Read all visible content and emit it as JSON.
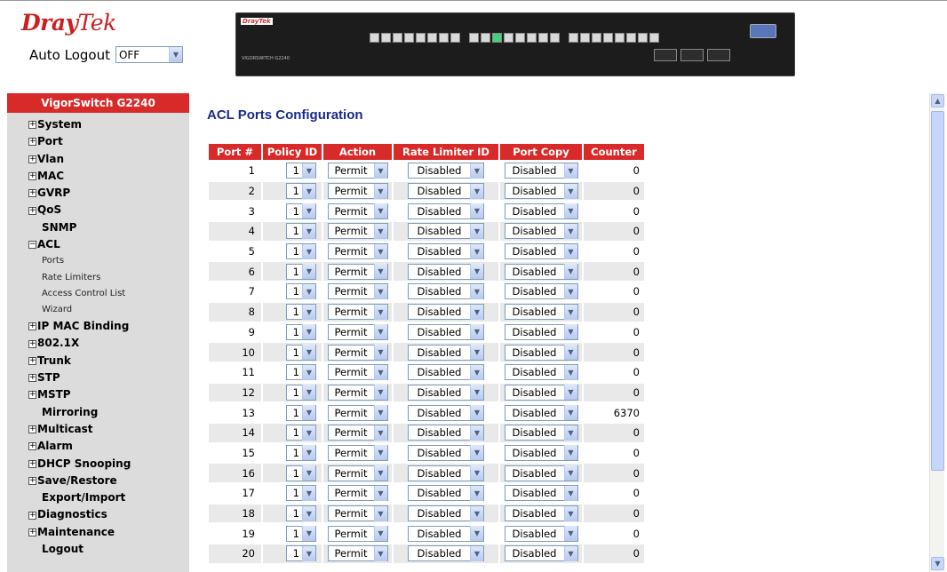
{
  "header": {
    "brand_bold": "Dray",
    "brand_light": "Tek",
    "auto_logout_label": "Auto Logout",
    "auto_logout_value": "OFF",
    "device_brand": "DrayTek",
    "device_model": "VIGORSWITCH G2240"
  },
  "sidebar": {
    "title": "VigorSwitch G2240",
    "items": [
      {
        "label": "System",
        "type": "collapsed"
      },
      {
        "label": "Port",
        "type": "collapsed"
      },
      {
        "label": "Vlan",
        "type": "collapsed"
      },
      {
        "label": "MAC",
        "type": "collapsed"
      },
      {
        "label": "GVRP",
        "type": "collapsed"
      },
      {
        "label": "QoS",
        "type": "collapsed"
      },
      {
        "label": "SNMP",
        "type": "leaf"
      },
      {
        "label": "ACL",
        "type": "expanded"
      },
      {
        "label": "Ports",
        "type": "sub"
      },
      {
        "label": "Rate Limiters",
        "type": "sub"
      },
      {
        "label": "Access Control List",
        "type": "sub"
      },
      {
        "label": "Wizard",
        "type": "sub"
      },
      {
        "label": "IP MAC Binding",
        "type": "collapsed"
      },
      {
        "label": "802.1X",
        "type": "collapsed"
      },
      {
        "label": "Trunk",
        "type": "collapsed"
      },
      {
        "label": "STP",
        "type": "collapsed"
      },
      {
        "label": "MSTP",
        "type": "collapsed"
      },
      {
        "label": "Mirroring",
        "type": "leaf"
      },
      {
        "label": "Multicast",
        "type": "collapsed"
      },
      {
        "label": "Alarm",
        "type": "collapsed"
      },
      {
        "label": "DHCP Snooping",
        "type": "collapsed"
      },
      {
        "label": "Save/Restore",
        "type": "collapsed"
      },
      {
        "label": "Export/Import",
        "type": "leaf"
      },
      {
        "label": "Diagnostics",
        "type": "collapsed"
      },
      {
        "label": "Maintenance",
        "type": "collapsed"
      },
      {
        "label": "Logout",
        "type": "leaf"
      }
    ]
  },
  "main": {
    "title": "ACL Ports Configuration",
    "columns": [
      "Port #",
      "Policy ID",
      "Action",
      "Rate Limiter ID",
      "Port Copy",
      "Counter"
    ],
    "rows": [
      {
        "port": "1",
        "policy": "1",
        "action": "Permit",
        "rate": "Disabled",
        "copy": "Disabled",
        "counter": "0"
      },
      {
        "port": "2",
        "policy": "1",
        "action": "Permit",
        "rate": "Disabled",
        "copy": "Disabled",
        "counter": "0"
      },
      {
        "port": "3",
        "policy": "1",
        "action": "Permit",
        "rate": "Disabled",
        "copy": "Disabled",
        "counter": "0"
      },
      {
        "port": "4",
        "policy": "1",
        "action": "Permit",
        "rate": "Disabled",
        "copy": "Disabled",
        "counter": "0"
      },
      {
        "port": "5",
        "policy": "1",
        "action": "Permit",
        "rate": "Disabled",
        "copy": "Disabled",
        "counter": "0"
      },
      {
        "port": "6",
        "policy": "1",
        "action": "Permit",
        "rate": "Disabled",
        "copy": "Disabled",
        "counter": "0"
      },
      {
        "port": "7",
        "policy": "1",
        "action": "Permit",
        "rate": "Disabled",
        "copy": "Disabled",
        "counter": "0"
      },
      {
        "port": "8",
        "policy": "1",
        "action": "Permit",
        "rate": "Disabled",
        "copy": "Disabled",
        "counter": "0"
      },
      {
        "port": "9",
        "policy": "1",
        "action": "Permit",
        "rate": "Disabled",
        "copy": "Disabled",
        "counter": "0"
      },
      {
        "port": "10",
        "policy": "1",
        "action": "Permit",
        "rate": "Disabled",
        "copy": "Disabled",
        "counter": "0"
      },
      {
        "port": "11",
        "policy": "1",
        "action": "Permit",
        "rate": "Disabled",
        "copy": "Disabled",
        "counter": "0"
      },
      {
        "port": "12",
        "policy": "1",
        "action": "Permit",
        "rate": "Disabled",
        "copy": "Disabled",
        "counter": "0"
      },
      {
        "port": "13",
        "policy": "1",
        "action": "Permit",
        "rate": "Disabled",
        "copy": "Disabled",
        "counter": "6370"
      },
      {
        "port": "14",
        "policy": "1",
        "action": "Permit",
        "rate": "Disabled",
        "copy": "Disabled",
        "counter": "0"
      },
      {
        "port": "15",
        "policy": "1",
        "action": "Permit",
        "rate": "Disabled",
        "copy": "Disabled",
        "counter": "0"
      },
      {
        "port": "16",
        "policy": "1",
        "action": "Permit",
        "rate": "Disabled",
        "copy": "Disabled",
        "counter": "0"
      },
      {
        "port": "17",
        "policy": "1",
        "action": "Permit",
        "rate": "Disabled",
        "copy": "Disabled",
        "counter": "0"
      },
      {
        "port": "18",
        "policy": "1",
        "action": "Permit",
        "rate": "Disabled",
        "copy": "Disabled",
        "counter": "0"
      },
      {
        "port": "19",
        "policy": "1",
        "action": "Permit",
        "rate": "Disabled",
        "copy": "Disabled",
        "counter": "0"
      },
      {
        "port": "20",
        "policy": "1",
        "action": "Permit",
        "rate": "Disabled",
        "copy": "Disabled",
        "counter": "0"
      }
    ]
  },
  "colors": {
    "accent_red": "#d92a2a",
    "title_blue": "#1a2b8a",
    "sidebar_bg": "#dcdcdc",
    "row_alt": "#e9e9e9"
  },
  "icons": {
    "collapsed": "plus-box-icon",
    "expanded": "minus-box-icon",
    "dropdown": "chevron-down-icon"
  }
}
